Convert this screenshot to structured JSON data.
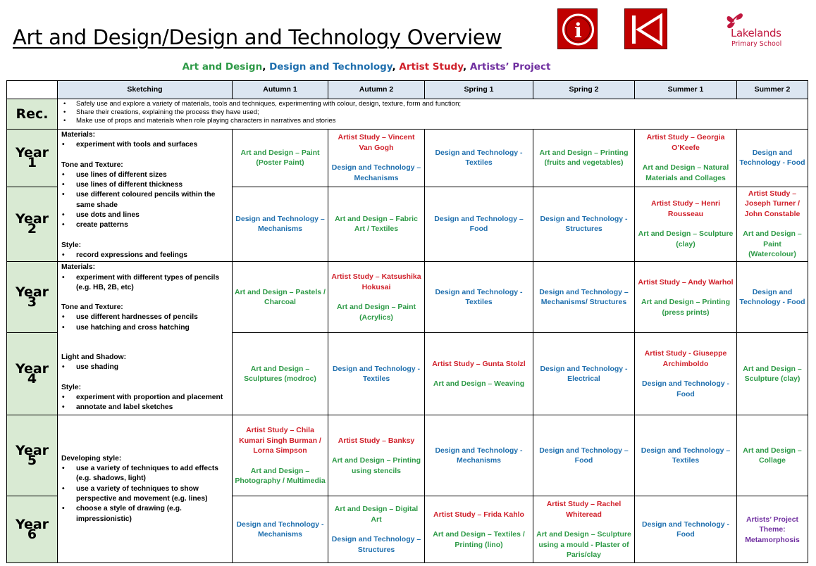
{
  "title": "Art and Design/Design and Technology Overview",
  "buttons": {
    "info_symbol": "i"
  },
  "logo": {
    "name": "Lakelands",
    "sub": "Primary School"
  },
  "legend": {
    "items": [
      {
        "text": "Art and Design",
        "sep": ", ",
        "color": "#2e9a47"
      },
      {
        "text": "Design and Technology",
        "sep": ", ",
        "color": "#1f6fae"
      },
      {
        "text": "Artist Study",
        "sep": ", ",
        "color": "#d0202a"
      },
      {
        "text": "Artists’ Project",
        "sep": "",
        "color": "#7030a0"
      }
    ]
  },
  "colors": {
    "art": "#2e9a47",
    "dt": "#1f6fae",
    "artist": "#d0202a",
    "project": "#7030a0",
    "header_bg": "#dce6f1",
    "year_bg": "#d9ead3",
    "button_red": "#c00000"
  },
  "headers": [
    "Sketching",
    "Autumn 1",
    "Autumn 2",
    "Spring 1",
    "Spring 2",
    "Summer 1",
    "Summer 2"
  ],
  "rec": {
    "label": "Rec.",
    "bullets": [
      "Safely use and explore a variety of materials, tools and techniques, experimenting with colour, design, texture, form and function;",
      "Share their creations, explaining the process they have used;",
      "Make use of props and materials when role playing characters in narratives and stories"
    ]
  },
  "sketching": {
    "y12": {
      "materials_h": "Materials:",
      "materials": [
        "experiment with tools and surfaces"
      ],
      "tone_h": "Tone and Texture:",
      "tone": [
        "use lines of different sizes",
        "use lines of different thickness",
        "use different coloured pencils within the same shade",
        "use dots and lines",
        "create patterns"
      ],
      "style_h": "Style:",
      "style": [
        "record expressions and feelings"
      ]
    },
    "y34": {
      "materials_h": "Materials:",
      "materials": [
        "experiment with different types of pencils (e.g. HB, 2B, etc)"
      ],
      "tone_h": "Tone and Texture:",
      "tone": [
        "use different hardnesses of pencils",
        "use hatching and cross hatching"
      ],
      "light_h": "Light and Shadow:",
      "light": [
        "use shading"
      ],
      "style_h": "Style:",
      "style": [
        "experiment with proportion and placement",
        "annotate and label sketches"
      ]
    },
    "y56": {
      "dev_h": "Developing style:",
      "dev": [
        "use a variety of techniques to add effects (e.g. shadows, light)",
        "use a variety of techniques to show perspective and movement (e.g. lines)",
        "choose a style of drawing (e.g. impressionistic)"
      ]
    }
  },
  "years": [
    {
      "label": "Year 1",
      "cells": [
        [
          [
            "g",
            "Art and Design – Paint (Poster Paint)"
          ]
        ],
        [
          [
            "r",
            "Artist Study – Vincent Van Gogh"
          ],
          [
            "b2",
            "Design and Technology – Mechanisms"
          ]
        ],
        [
          [
            "b2",
            "Design and Technology - Textiles"
          ]
        ],
        [
          [
            "g",
            "Art and Design – Printing (fruits and vegetables)"
          ]
        ],
        [
          [
            "r",
            "Artist Study – Georgia O’Keefe"
          ],
          [
            "g",
            "Art and Design – Natural Materials and Collages"
          ]
        ],
        [
          [
            "b2",
            "Design and Technology - Food"
          ]
        ]
      ]
    },
    {
      "label": "Year 2",
      "cells": [
        [
          [
            "b2",
            "Design and Technology – Mechanisms"
          ]
        ],
        [
          [
            "g",
            "Art and Design – Fabric Art / Textiles"
          ]
        ],
        [
          [
            "b2",
            "Design and Technology – Food"
          ]
        ],
        [
          [
            "b2",
            "Design and Technology - Structures"
          ]
        ],
        [
          [
            "r",
            "Artist Study – Henri Rousseau"
          ],
          [
            "g",
            "Art and Design – Sculpture (clay)"
          ]
        ],
        [
          [
            "r",
            "Artist Study – Joseph Turner / John Constable"
          ],
          [
            "g",
            "Art and Design – Paint (Watercolour)"
          ]
        ]
      ]
    },
    {
      "label": "Year 3",
      "cells": [
        [
          [
            "g",
            "Art and Design – Pastels / Charcoal"
          ]
        ],
        [
          [
            "r",
            "Artist Study – Katsushika Hokusai"
          ],
          [
            "g",
            "Art and Design – Paint (Acrylics)"
          ]
        ],
        [
          [
            "b2",
            "Design and Technology - Textiles"
          ]
        ],
        [
          [
            "b2",
            "Design and Technology – Mechanisms/ Structures"
          ]
        ],
        [
          [
            "r",
            "Artist Study – Andy Warhol"
          ],
          [
            "g",
            "Art and Design – Printing (press prints)"
          ]
        ],
        [
          [
            "b2",
            "Design and Technology - Food"
          ]
        ]
      ]
    },
    {
      "label": "Year 4",
      "cells": [
        [
          [
            "g",
            "Art and Design – Sculptures (modroc)"
          ]
        ],
        [
          [
            "b2",
            "Design and Technology - Textiles"
          ]
        ],
        [
          [
            "r",
            "Artist Study – Gunta Stolzl"
          ],
          [
            "g",
            "Art and Design – Weaving"
          ]
        ],
        [
          [
            "b2",
            "Design and Technology - Electrical"
          ]
        ],
        [
          [
            "r",
            "Artist Study - Giuseppe Archimboldo"
          ],
          [
            "b2",
            "Design and Technology - Food"
          ]
        ],
        [
          [
            "g",
            "Art and Design – Sculpture (clay)"
          ]
        ]
      ]
    },
    {
      "label": "Year 5",
      "cells": [
        [
          [
            "r",
            "Artist Study – Chila Kumari Singh Burman / Lorna Simpson"
          ],
          [
            "g",
            "Art and Design – Photography / Multimedia"
          ]
        ],
        [
          [
            "r",
            "Artist Study – Banksy"
          ],
          [
            "g",
            "Art and Design – Printing using stencils"
          ]
        ],
        [
          [
            "b2",
            "Design and Technology - Mechanisms"
          ]
        ],
        [
          [
            "b2",
            "Design and Technology – Food"
          ]
        ],
        [
          [
            "b2",
            "Design and Technology – Textiles"
          ]
        ],
        [
          [
            "g",
            "Art and Design – Collage"
          ]
        ]
      ]
    },
    {
      "label": "Year 6",
      "cells": [
        [
          [
            "b2",
            "Design and Technology - Mechanisms"
          ]
        ],
        [
          [
            "g",
            "Art and Design – Digital Art"
          ],
          [
            "b2",
            "Design and Technology – Structures"
          ]
        ],
        [
          [
            "r",
            "Artist Study – Frida Kahlo"
          ],
          [
            "g",
            "Art and Design – Textiles / Printing (lino)"
          ]
        ],
        [
          [
            "r",
            "Artist Study – Rachel Whiteread"
          ],
          [
            "g",
            "Art and Design – Sculpture using a mould - Plaster of Paris/clay"
          ]
        ],
        [
          [
            "b2",
            "Design and Technology - Food"
          ]
        ],
        [
          [
            "p",
            "Artists’ Project Theme: Metamorphosis"
          ]
        ]
      ]
    }
  ]
}
